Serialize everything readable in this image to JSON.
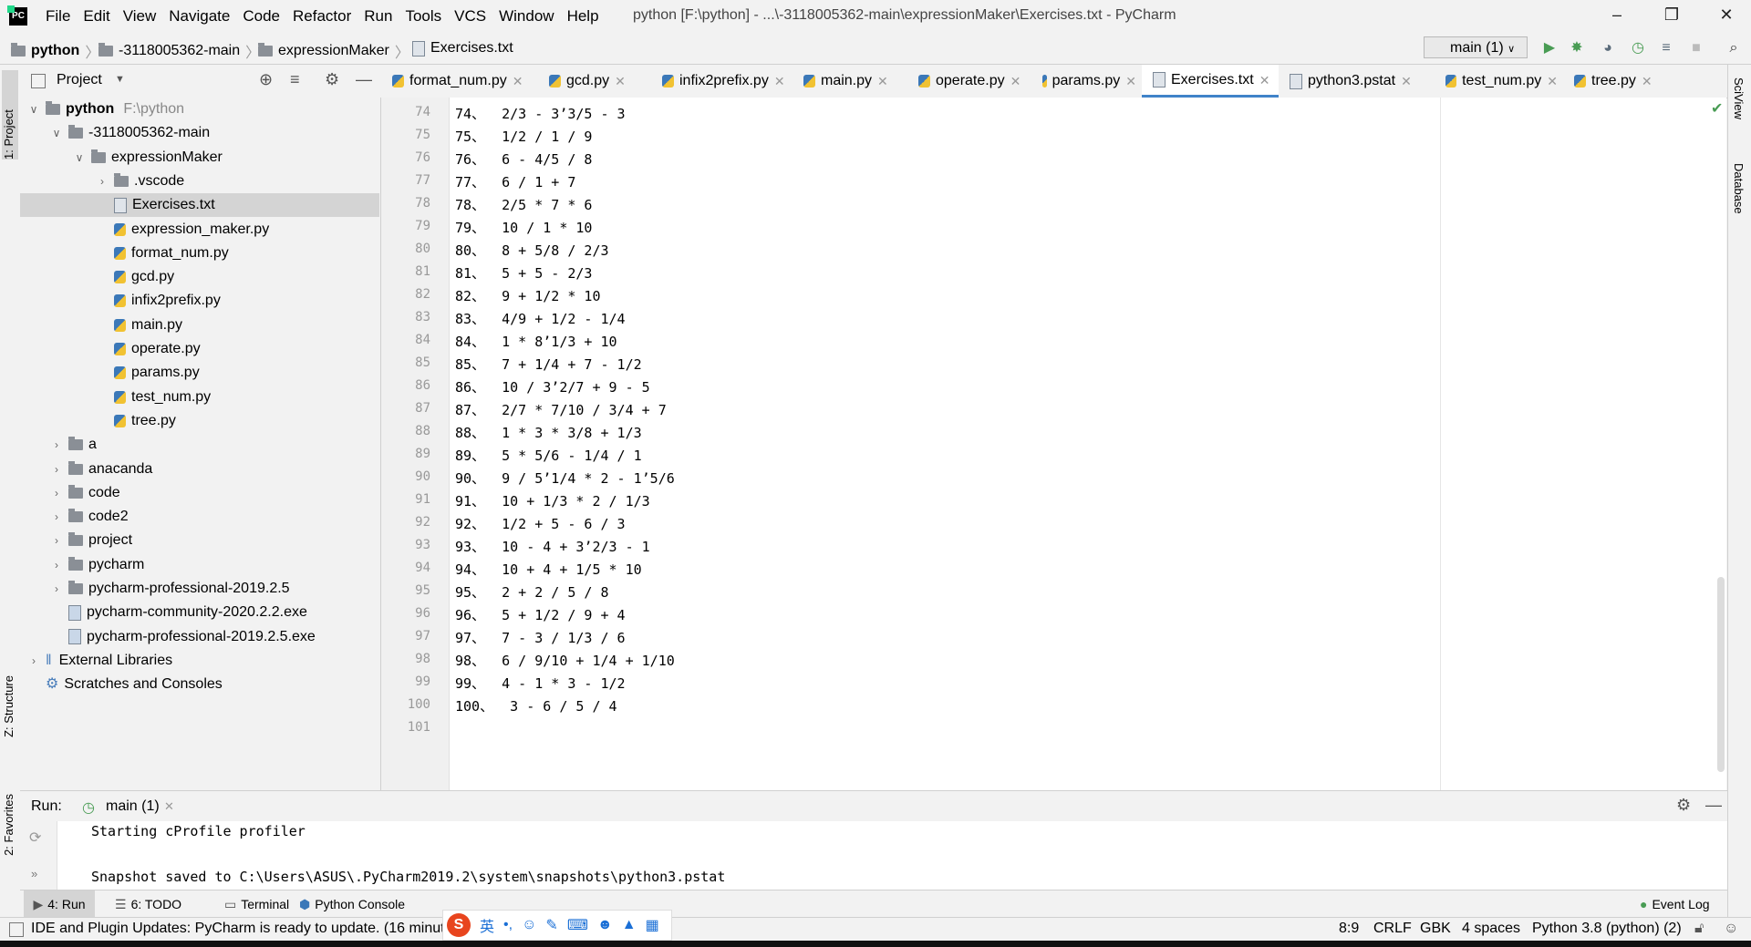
{
  "menu": [
    "File",
    "Edit",
    "View",
    "Navigate",
    "Code",
    "Refactor",
    "Run",
    "Tools",
    "VCS",
    "Window",
    "Help"
  ],
  "window_title": "python [F:\\python] - ...\\-3118005362-main\\expressionMaker\\Exercises.txt - PyCharm",
  "breadcrumbs": [
    "python",
    "-3118005362-main",
    "expressionMaker",
    "Exercises.txt"
  ],
  "run_config": "main (1)",
  "left_stripe": {
    "project": "1: Project",
    "structure": "Z: Structure",
    "favorites": "2: Favorites"
  },
  "right_stripe": {
    "sciview": "SciView",
    "database": "Database"
  },
  "project_panel": {
    "title": "Project",
    "tree": [
      {
        "label": "python",
        "extra": "F:\\python",
        "kind": "folder",
        "depth": 0,
        "expanded": true
      },
      {
        "label": "-3118005362-main",
        "kind": "folder",
        "depth": 1,
        "expanded": true
      },
      {
        "label": "expressionMaker",
        "kind": "folder",
        "depth": 2,
        "expanded": true
      },
      {
        "label": ".vscode",
        "kind": "folder",
        "depth": 3,
        "expanded": false
      },
      {
        "label": "Exercises.txt",
        "kind": "file",
        "depth": 3,
        "selected": true
      },
      {
        "label": "expression_maker.py",
        "kind": "py",
        "depth": 3
      },
      {
        "label": "format_num.py",
        "kind": "py",
        "depth": 3
      },
      {
        "label": "gcd.py",
        "kind": "py",
        "depth": 3
      },
      {
        "label": "infix2prefix.py",
        "kind": "py",
        "depth": 3
      },
      {
        "label": "main.py",
        "kind": "py",
        "depth": 3
      },
      {
        "label": "operate.py",
        "kind": "py",
        "depth": 3
      },
      {
        "label": "params.py",
        "kind": "py",
        "depth": 3
      },
      {
        "label": "test_num.py",
        "kind": "py",
        "depth": 3
      },
      {
        "label": "tree.py",
        "kind": "py",
        "depth": 3
      },
      {
        "label": "a",
        "kind": "folder",
        "depth": 1,
        "expanded": false
      },
      {
        "label": "anacanda",
        "kind": "folder",
        "depth": 1,
        "expanded": false
      },
      {
        "label": "code",
        "kind": "folder",
        "depth": 1,
        "expanded": false
      },
      {
        "label": "code2",
        "kind": "folder",
        "depth": 1,
        "expanded": false
      },
      {
        "label": "project",
        "kind": "folder",
        "depth": 1,
        "expanded": false
      },
      {
        "label": "pycharm",
        "kind": "folder",
        "depth": 1,
        "expanded": false
      },
      {
        "label": "pycharm-professional-2019.2.5",
        "kind": "folder",
        "depth": 1,
        "expanded": false
      },
      {
        "label": "pycharm-community-2020.2.2.exe",
        "kind": "exe",
        "depth": 1
      },
      {
        "label": "pycharm-professional-2019.2.5.exe",
        "kind": "exe",
        "depth": 1
      },
      {
        "label": "External Libraries",
        "kind": "lib",
        "depth": 0,
        "expanded": false
      },
      {
        "label": "Scratches and Consoles",
        "kind": "scratch",
        "depth": 0
      }
    ]
  },
  "editor_tabs": [
    {
      "label": "format_num.py",
      "active": false
    },
    {
      "label": "gcd.py",
      "active": false
    },
    {
      "label": "infix2prefix.py",
      "active": false
    },
    {
      "label": "main.py",
      "active": false
    },
    {
      "label": "operate.py",
      "active": false
    },
    {
      "label": "params.py",
      "active": false
    },
    {
      "label": "Exercises.txt",
      "active": true
    },
    {
      "label": "python3.pstat",
      "active": false
    },
    {
      "label": "test_num.py",
      "active": false
    },
    {
      "label": "tree.py",
      "active": false
    }
  ],
  "editor": {
    "lines": [
      {
        "n": "74",
        "text": "74、  2/3 - 3’3/5 - 3"
      },
      {
        "n": "75",
        "text": "75、  1/2 / 1 / 9"
      },
      {
        "n": "76",
        "text": "76、  6 - 4/5 / 8"
      },
      {
        "n": "77",
        "text": "77、  6 / 1 + 7"
      },
      {
        "n": "78",
        "text": "78、  2/5 * 7 * 6"
      },
      {
        "n": "79",
        "text": "79、  10 / 1 * 10"
      },
      {
        "n": "80",
        "text": "80、  8 + 5/8 / 2/3"
      },
      {
        "n": "81",
        "text": "81、  5 + 5 - 2/3"
      },
      {
        "n": "82",
        "text": "82、  9 + 1/2 * 10"
      },
      {
        "n": "83",
        "text": "83、  4/9 + 1/2 - 1/4"
      },
      {
        "n": "84",
        "text": "84、  1 * 8’1/3 + 10"
      },
      {
        "n": "85",
        "text": "85、  7 + 1/4 + 7 - 1/2"
      },
      {
        "n": "86",
        "text": "86、  10 / 3’2/7 + 9 - 5"
      },
      {
        "n": "87",
        "text": "87、  2/7 * 7/10 / 3/4 + 7"
      },
      {
        "n": "88",
        "text": "88、  1 * 3 * 3/8 + 1/3"
      },
      {
        "n": "89",
        "text": "89、  5 * 5/6 - 1/4 / 1"
      },
      {
        "n": "90",
        "text": "90、  9 / 5’1/4 * 2 - 1’5/6"
      },
      {
        "n": "91",
        "text": "91、  10 + 1/3 * 2 / 1/3"
      },
      {
        "n": "92",
        "text": "92、  1/2 + 5 - 6 / 3"
      },
      {
        "n": "93",
        "text": "93、  10 - 4 + 3’2/3 - 1"
      },
      {
        "n": "94",
        "text": "94、  10 + 4 + 1/5 * 10"
      },
      {
        "n": "95",
        "text": "95、  2 + 2 / 5 / 8"
      },
      {
        "n": "96",
        "text": "96、  5 + 1/2 / 9 + 4"
      },
      {
        "n": "97",
        "text": "97、  7 - 3 / 1/3 / 6"
      },
      {
        "n": "98",
        "text": "98、  6 / 9/10 + 1/4 + 1/10"
      },
      {
        "n": "99",
        "text": "99、  4 - 1 * 3 - 1/2"
      },
      {
        "n": "100",
        "text": "100、  3 - 6 / 5 / 4"
      },
      {
        "n": "101",
        "text": ""
      }
    ]
  },
  "run_panel": {
    "label": "Run:",
    "tab": "main (1)",
    "output": [
      "Starting cProfile profiler",
      "",
      "Snapshot saved to C:\\Users\\ASUS\\.PyCharm2019.2\\system\\snapshots\\python3.pstat"
    ]
  },
  "tool_tabs": [
    "4: Run",
    "6: TODO",
    "Terminal",
    "Python Console"
  ],
  "event_log": "Event Log",
  "status": {
    "message": "IDE and Plugin Updates: PyCharm is ready to update. (16 minut",
    "position": "8:9",
    "line_sep": "CRLF",
    "encoding": "GBK",
    "indent": "4 spaces",
    "interpreter": "Python 3.8 (python) (2)"
  },
  "ime": {
    "lang": "英"
  },
  "colors": {
    "accent": "#4083c9",
    "run_green": "#499c54",
    "selection": "#d4d4d4"
  }
}
